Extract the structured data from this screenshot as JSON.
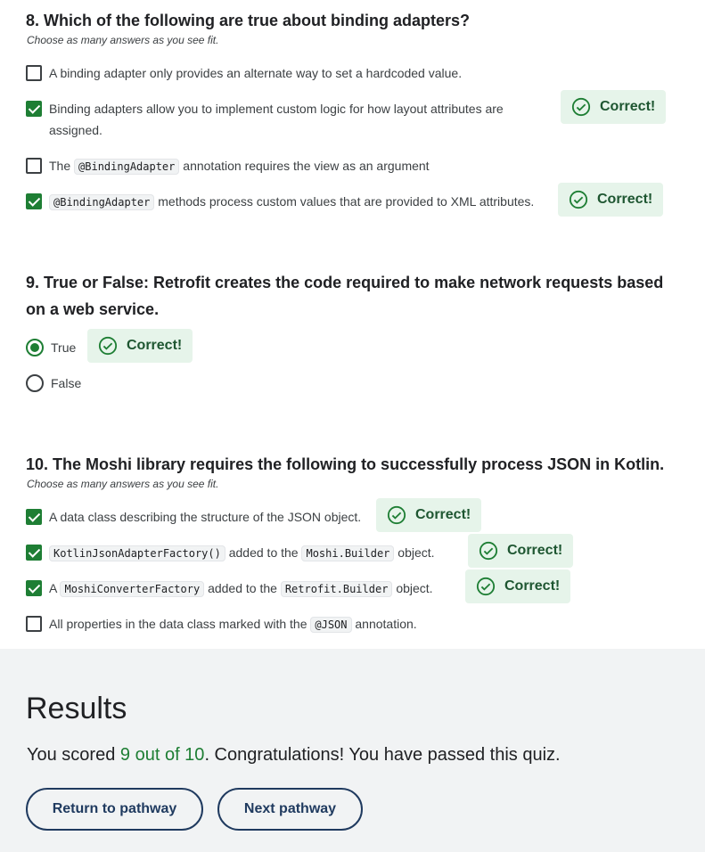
{
  "q8": {
    "title": "8. Which of the following are true about binding adapters?",
    "hint": "Choose as many answers as you see fit.",
    "opt1": "A binding adapter only provides an alternate way to set a hardcoded value.",
    "opt2": "Binding adapters allow you to implement custom logic for how layout attributes are assigned.",
    "opt3_pre": "The",
    "opt3_code": "@BindingAdapter",
    "opt3_post": "annotation requires the view as an argument",
    "opt4_code": "@BindingAdapter",
    "opt4_post": "methods process custom values that are provided to XML attributes."
  },
  "q9": {
    "title": "9. True or False: Retrofit creates the code required to make network requests based on a web service.",
    "opt_true": "True",
    "opt_false": "False"
  },
  "q10": {
    "title": "10. The Moshi library requires the following to successfully process JSON in Kotlin.",
    "hint": "Choose as many answers as you see fit.",
    "opt1": "A data class describing the structure of the JSON object.",
    "opt2_code": "KotlinJsonAdapterFactory()",
    "opt2_mid": "added to the",
    "opt2_code2": "Moshi.Builder",
    "opt2_post": "object.",
    "opt3_pre": "A",
    "opt3_code": "MoshiConverterFactory",
    "opt3_mid": "added to the",
    "opt3_code2": "Retrofit.Builder",
    "opt3_post": "object.",
    "opt4_pre": "All properties in the data class marked with the",
    "opt4_code": "@JSON",
    "opt4_post": "annotation."
  },
  "badge": {
    "label": "Correct!",
    "icon": "check-circle-icon",
    "color": "#1e7e34",
    "bg": "#e6f4ea"
  },
  "results": {
    "title": "Results",
    "text_pre": "You scored",
    "score": "9 out of 10",
    "text_post": ". Congratulations! You have passed this quiz.",
    "btn_return": "Return to pathway",
    "btn_next": "Next pathway"
  }
}
